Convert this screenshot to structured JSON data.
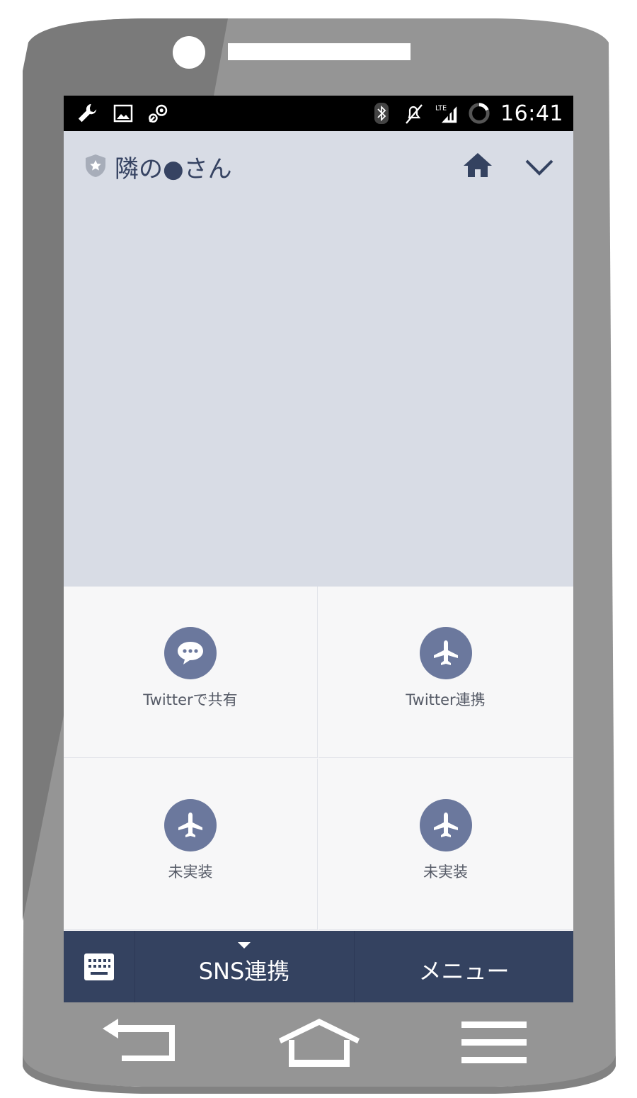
{
  "status_bar": {
    "left_icons": [
      "wrench-icon",
      "image-icon",
      "sync-icon"
    ],
    "right_icons": [
      "bluetooth-icon",
      "mute-icon",
      "lte-signal-icon",
      "loading-ring-icon"
    ],
    "network": "LTE",
    "time": "16:41"
  },
  "header": {
    "shield_icon": "shield-star-icon",
    "title": "隣の●さん",
    "home_icon": "home-icon",
    "expand_icon": "chevron-down-icon"
  },
  "grid": {
    "items": [
      {
        "label": "Twitterで共有",
        "icon": "chat-bubble-icon"
      },
      {
        "label": "Twitter連携",
        "icon": "airplane-icon"
      },
      {
        "label": "未実装",
        "icon": "airplane-icon"
      },
      {
        "label": "未実装",
        "icon": "airplane-icon"
      }
    ]
  },
  "bottom_bar": {
    "keyboard_icon": "keyboard-icon",
    "sns_label": "SNS連携",
    "menu_label": "メニュー"
  },
  "nav_keys": [
    "back-icon",
    "home-key-icon",
    "menu-key-icon"
  ],
  "colors": {
    "header_bg": "#d8dce5",
    "accent_dark": "#344260",
    "icon_circle": "#6b789d",
    "frame": "#959595"
  }
}
